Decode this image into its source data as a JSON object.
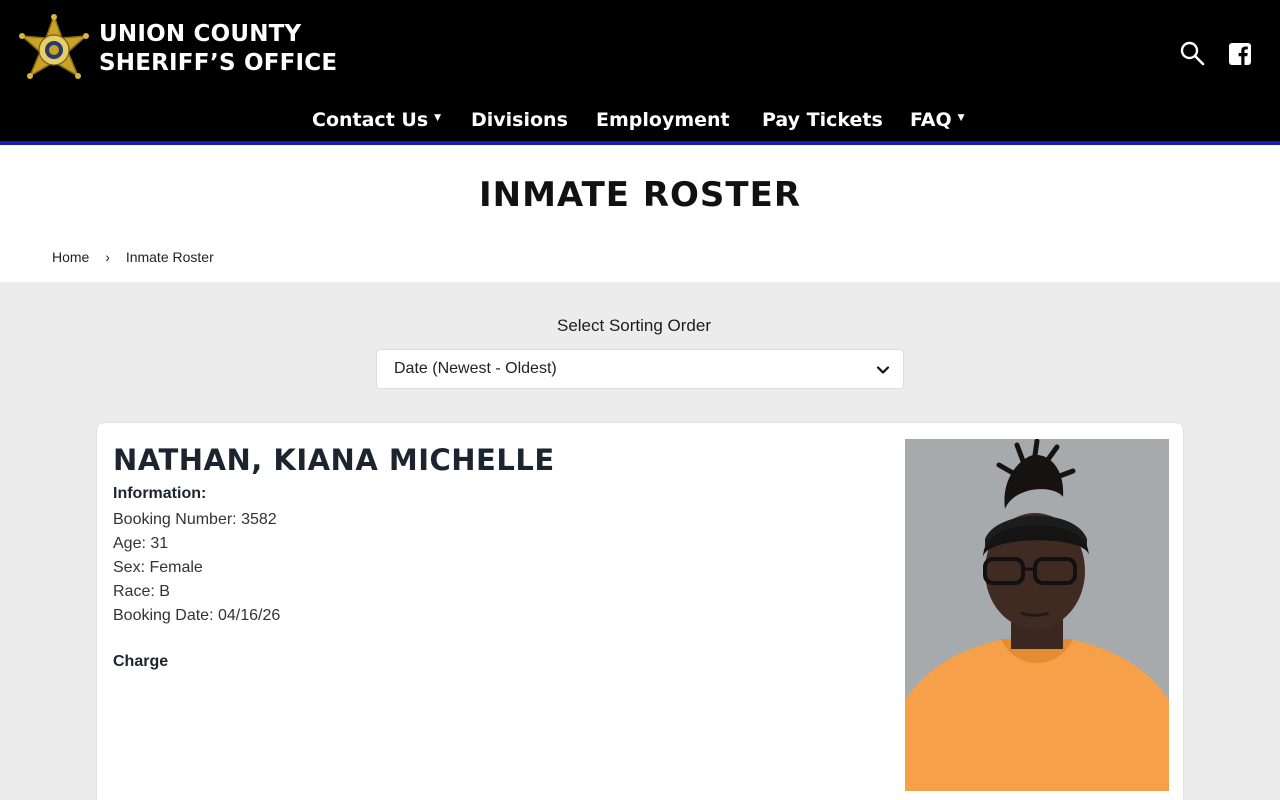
{
  "header": {
    "brand_line1": "UNION COUNTY",
    "brand_line2": "SHERIFF’S OFFICE",
    "badge_icon": "sheriff-star-badge",
    "search_icon": "search-icon",
    "facebook_icon": "facebook-icon",
    "accent_color": "#1a1ab8"
  },
  "nav": {
    "items": [
      {
        "label": "Contact Us",
        "has_dropdown": true
      },
      {
        "label": "Divisions",
        "has_dropdown": false
      },
      {
        "label": "Employment",
        "has_dropdown": false
      },
      {
        "label": "Pay Tickets",
        "has_dropdown": false
      },
      {
        "label": "FAQ",
        "has_dropdown": true
      }
    ]
  },
  "page": {
    "title": "INMATE ROSTER",
    "breadcrumb": {
      "home": "Home",
      "separator": "›",
      "current": "Inmate Roster"
    }
  },
  "sort": {
    "label": "Select Sorting Order",
    "selected": "Date (Newest - Oldest)"
  },
  "inmate": {
    "name": "NATHAN, KIANA MICHELLE",
    "info_heading": "Information:",
    "booking_number": "Booking Number: 3582",
    "age": "Age: 31",
    "sex": "Sex: Female",
    "race": "Race: B",
    "booking_date": "Booking Date: 04/16/26",
    "charge_heading": "Charge"
  }
}
